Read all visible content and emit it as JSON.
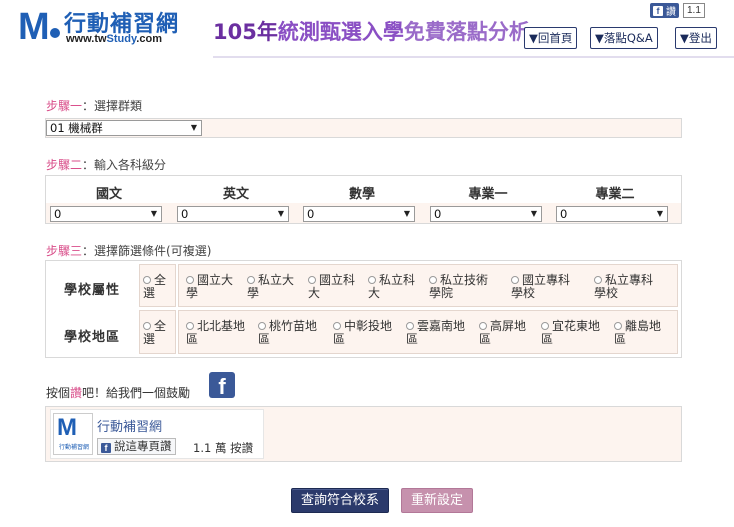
{
  "header": {
    "logo_title": "行動補習網",
    "logo_url_pre": "www.tw",
    "logo_url_mid": "Study",
    "logo_url_post": ".com",
    "title_a": "105年",
    "title_b": "統測甄選入學",
    "title_c": "免費落點分析",
    "fb_like_label": "讚",
    "fb_like_count": "1.1",
    "nav": [
      {
        "label": "▼回首頁"
      },
      {
        "label": "▼落點Q&A"
      },
      {
        "label": "▼登出"
      }
    ]
  },
  "step1": {
    "num": "步驟一",
    "text": "：選擇群類",
    "group_value": "01 機械群"
  },
  "step2": {
    "num": "步驟二",
    "text": "：輸入各科級分",
    "subjects": [
      {
        "name": "國文",
        "value": "0"
      },
      {
        "name": "英文",
        "value": "0"
      },
      {
        "name": "數學",
        "value": "0"
      },
      {
        "name": "專業一",
        "value": "0"
      },
      {
        "name": "專業二",
        "value": "0"
      }
    ]
  },
  "step3": {
    "num": "步驟三",
    "text": "：選擇篩選條件(可複選)",
    "school_type": {
      "label": "學校屬性",
      "all_line1": "全",
      "all_line2": "選",
      "options": [
        {
          "l1": "國立大",
          "l2": "學"
        },
        {
          "l1": "私立大",
          "l2": "學"
        },
        {
          "l1": "國立科",
          "l2": "大"
        },
        {
          "l1": "私立科",
          "l2": "大"
        },
        {
          "l1": "私立技術",
          "l2": "學院"
        },
        {
          "l1": "國立專科",
          "l2": "學校"
        },
        {
          "l1": "私立專科",
          "l2": "學校"
        }
      ]
    },
    "region": {
      "label": "學校地區",
      "all_line1": "全",
      "all_line2": "選",
      "options": [
        {
          "l1": "北北基地",
          "l2": "區"
        },
        {
          "l1": "桃竹苗地",
          "l2": "區"
        },
        {
          "l1": "中彰投地",
          "l2": "區"
        },
        {
          "l1": "雲嘉南地",
          "l2": "區"
        },
        {
          "l1": "高屏地",
          "l2": "區"
        },
        {
          "l1": "宜花東地",
          "l2": "區"
        },
        {
          "l1": "離島地",
          "l2": "區"
        }
      ]
    }
  },
  "like_prompt": {
    "pre": "按個",
    "hl": "讚",
    "post": "吧！給我們一個鼓勵"
  },
  "fb_widget": {
    "page_name": "行動補習網",
    "thumb_caption": "行動補習網",
    "like_button": "說這專頁讚",
    "count_text": "1.1 萬 按讚"
  },
  "buttons": {
    "query": "查詢符合校系",
    "reset": "重新設定"
  }
}
